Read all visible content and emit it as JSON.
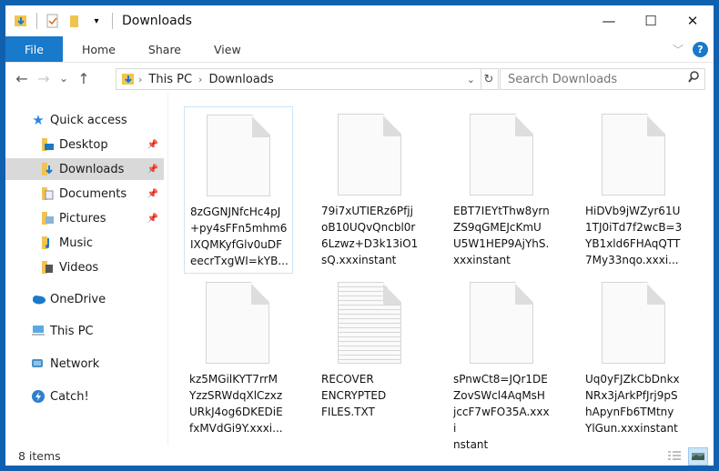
{
  "window": {
    "title": "Downloads",
    "controls": {
      "minimize": "—",
      "maximize": "☐",
      "close": "✕"
    }
  },
  "ribbon": {
    "tabs": [
      {
        "label": "File",
        "active": true
      },
      {
        "label": "Home"
      },
      {
        "label": "Share"
      },
      {
        "label": "View"
      }
    ],
    "expand_glyph": "﹀",
    "help_glyph": "?"
  },
  "nav": {
    "back": "←",
    "forward": "→",
    "recent": "⌄",
    "up": "↑",
    "breadcrumb": [
      "This PC",
      "Downloads"
    ],
    "breadcrumb_sep": "›",
    "dropdown_glyph": "⌄",
    "refresh_glyph": "↻",
    "search_placeholder": "Search Downloads",
    "search_glyph": "⚲"
  },
  "sidebar": {
    "quick_access": "Quick access",
    "items": [
      {
        "label": "Desktop",
        "pinned": true
      },
      {
        "label": "Downloads",
        "pinned": true,
        "selected": true
      },
      {
        "label": "Documents",
        "pinned": true
      },
      {
        "label": "Pictures",
        "pinned": true
      },
      {
        "label": "Music",
        "pinned": false
      },
      {
        "label": "Videos",
        "pinned": false
      }
    ],
    "locations": [
      {
        "label": "OneDrive"
      },
      {
        "label": "This PC"
      },
      {
        "label": "Network"
      },
      {
        "label": "Catch!"
      }
    ],
    "pin_glyph": "📌"
  },
  "files": [
    {
      "name": "8zGGNJNfcHc4pJ+py4sFFn5mhm6IXQMKyfGlv0uDFeecrTxgWI=kYB...",
      "type": "blank",
      "selected": true
    },
    {
      "name": "79i7xUTIERz6PfjjoB10UQvQncbl0r6Lzwz+D3k13iO1sQ.xxxinstant",
      "type": "blank"
    },
    {
      "name": "EBT7IEYtThw8yrnZS9qGMEJcKmUU5W1HEP9AjYhS.xxxinstant",
      "type": "blank"
    },
    {
      "name": "HiDVb9jWZyr61U1TJ0iTd7f2wcB=3YB1xld6FHAqQTT7My33nqo.xxxi...",
      "type": "blank"
    },
    {
      "name": "kz5MGilKYT7rrMYzzSRWdqXlCzxzURkJ4og6DKEDiEfxMVdGi9Y.xxxi...",
      "type": "blank"
    },
    {
      "name": "RECOVER ENCRYPTED FILES.TXT",
      "type": "text"
    },
    {
      "name": "sPnwCt8=JQr1DEZovSWcl4AqMsHjccF7wFO35A.xxxinstant",
      "type": "blank"
    },
    {
      "name": "Uq0yFJZkCbDnkxNRx3jArkPfJrj9pShApynFb6TMtnyYlGun.xxxinstant",
      "type": "blank"
    }
  ],
  "file_lines": [
    [
      "8zGGNJNfcHc4pJ",
      "+py4sFFn5mhm6",
      "IXQMKyfGlv0uDF",
      "eecrTxgWI=kYB..."
    ],
    [
      "79i7xUTIERz6Pfjj",
      "oB10UQvQncbl0r",
      "6Lzwz+D3k13iO1",
      "sQ.xxxinstant"
    ],
    [
      "EBT7IEYtThw8yrn",
      "ZS9qGMEJcKmU",
      "U5W1HEP9AjYhS.",
      "xxxinstant"
    ],
    [
      "HiDVb9jWZyr61U",
      "1TJ0iTd7f2wcB=3",
      "YB1xld6FHAqQTT",
      "7My33nqo.xxxi..."
    ],
    [
      "kz5MGilKYT7rrM",
      "YzzSRWdqXlCzxz",
      "URkJ4og6DKEDiE",
      "fxMVdGi9Y.xxxi..."
    ],
    [
      "RECOVER",
      "ENCRYPTED",
      "FILES.TXT",
      ""
    ],
    [
      "sPnwCt8=JQr1DE",
      "ZovSWcl4AqMsH",
      "jccF7wFO35A.xxxi",
      "nstant"
    ],
    [
      "Uq0yFJZkCbDnkx",
      "NRx3jArkPfJrj9pS",
      "hApynFb6TMtny",
      "YlGun.xxxinstant"
    ]
  ],
  "status": {
    "item_count": "8 items"
  },
  "colors": {
    "accent": "#1979ca",
    "frame": "#1160b0",
    "selection": "#cce4f7"
  }
}
